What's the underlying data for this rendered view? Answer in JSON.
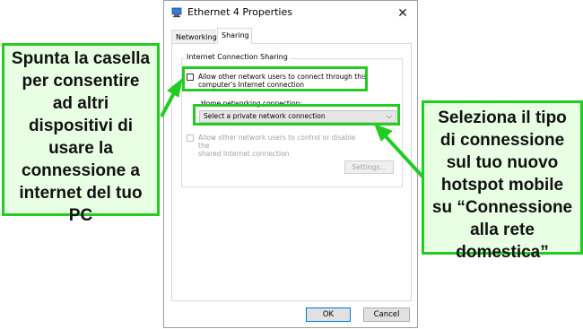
{
  "dialog": {
    "title": "Ethernet 4 Properties",
    "close_glyph": "✕",
    "tabs": [
      {
        "label": "Networking"
      },
      {
        "label": "Sharing"
      }
    ],
    "group_label": "Internet Connection Sharing",
    "allow_connect": {
      "line1": "Allow other network users to connect through this",
      "line2": "computer's Internet connection",
      "checked": false
    },
    "home_label": "Home networking connection:",
    "home_select_value": "Select a private network connection",
    "allow_control": {
      "line1": "Allow other network users to control or disable the",
      "line2": "shared Internet connection",
      "checked": false,
      "disabled": true
    },
    "settings_label": "Settings...",
    "ok_label": "OK",
    "cancel_label": "Cancel"
  },
  "annotations": {
    "left_lines": [
      "Spunta la casella",
      "per consentire",
      "ad altri",
      "dispositivi di",
      "usare la",
      "connessione a",
      "internet del tuo",
      "PC"
    ],
    "right_lines": [
      "Seleziona il tipo",
      "di connessione",
      "sul tuo nuovo",
      "hotspot mobile",
      "su “Connessione",
      "alla rete",
      "domestica”"
    ],
    "accent_color": "#22cc22",
    "fill_color": "#e8ffe4"
  },
  "icons": {
    "title_icon": "network-adapter-icon",
    "dropdown_icon": "chevron-down-icon"
  }
}
